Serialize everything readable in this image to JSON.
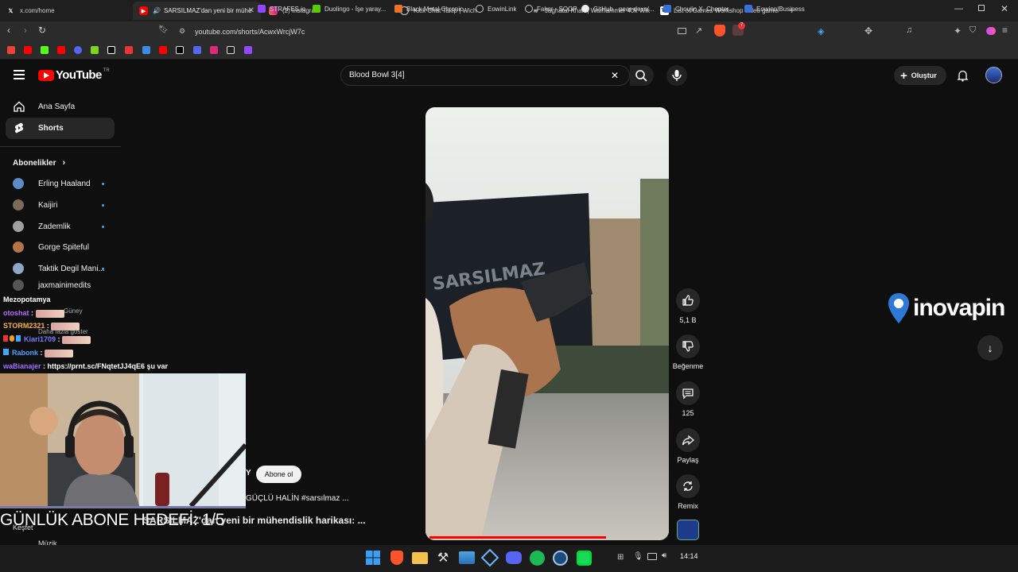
{
  "browser": {
    "tabs": [
      {
        "label": "x.com/home",
        "icon": "x-logo-icon"
      },
      {
        "label": "SARSILMAZ'dan yeni bir mühendi",
        "icon": "youtube-icon",
        "active": true
      },
      {
        "label": "(2) Instagram",
        "icon": "instagram-icon"
      },
      {
        "label": "Kick Chat Takip | Wich",
        "icon": "globe-icon"
      },
      {
        "label": "Jaghatai Khan | Warhammer 40k Wik",
        "icon": "wiki-icon"
      },
      {
        "label": "List of Games Workshop video game",
        "icon": "wikipedia-icon"
      }
    ],
    "new_tab": "+",
    "url": "youtube.com/shorts/AcwxWrcjW7c",
    "bookmarks": [
      "STRAFES.io",
      "Duolingo - İşe yaray...",
      "Black Metal Chronic...",
      "EowinLink",
      "Faker - SOOP",
      "GitHub - pear-devs/...",
      "Choujin X, Chapter...",
      "Eowinn|Business"
    ],
    "badge_count": "7"
  },
  "youtube": {
    "logo_text": "YouTube",
    "region": "TR",
    "search_value": "Blood Bowl 3[4]",
    "create_label": "Oluştur",
    "sidebar": {
      "home": "Ana Sayfa",
      "shorts": "Shorts",
      "subscriptions_header": "Abonelikler",
      "channels": [
        {
          "name": "Erling Haaland",
          "color": "#5b8cc7"
        },
        {
          "name": "Kaijiri",
          "color": "#7a6a5a"
        },
        {
          "name": "Zademlik",
          "color": "#a0a0a0"
        },
        {
          "name": "Gorge Spiteful",
          "color": "#b5734a"
        },
        {
          "name": "Taktik Degil Mani...",
          "color": "#8fa7c4"
        },
        {
          "name": "jaxmainimedits",
          "color": "#555555"
        }
      ],
      "hidden_1": "Güney",
      "show_more": "Daha fazla göster",
      "explore": "Keşfet",
      "music": "Müzik"
    },
    "actions": {
      "likes": "5,1 B",
      "dislike": "Beğenme",
      "comments": "125",
      "share": "Paylaş",
      "remix": "Remix"
    },
    "subscribe_label": "Abone ol",
    "description": "GÜÇLÜ HALİN #sarsılmaz ...",
    "title": "SARSILMAZ'dan yeni bir mühendislik harikası: ...",
    "overlay_goal": "GÜNLÜK ABONE HEDEFİ: 1/5",
    "sponsor_logo": "inovapin",
    "progress": 0.75
  },
  "chat": {
    "header": "Mezopotamya",
    "messages": [
      {
        "user": "otoshat",
        "color": "#b56cff",
        "text": ""
      },
      {
        "user": "STORM2321",
        "color": "#ffb13b",
        "text": ""
      },
      {
        "user": "Kiari1709",
        "color": "#7b7bff",
        "text": ""
      },
      {
        "user": "Rabonk",
        "color": "#4ea1ff",
        "text": ""
      },
      {
        "user": "waBianajer",
        "color": "#a070ff",
        "text": "https://prnt.sc/FNqtetJJ4qE6 şu var"
      }
    ]
  },
  "taskbar": {
    "time": "14:14"
  }
}
